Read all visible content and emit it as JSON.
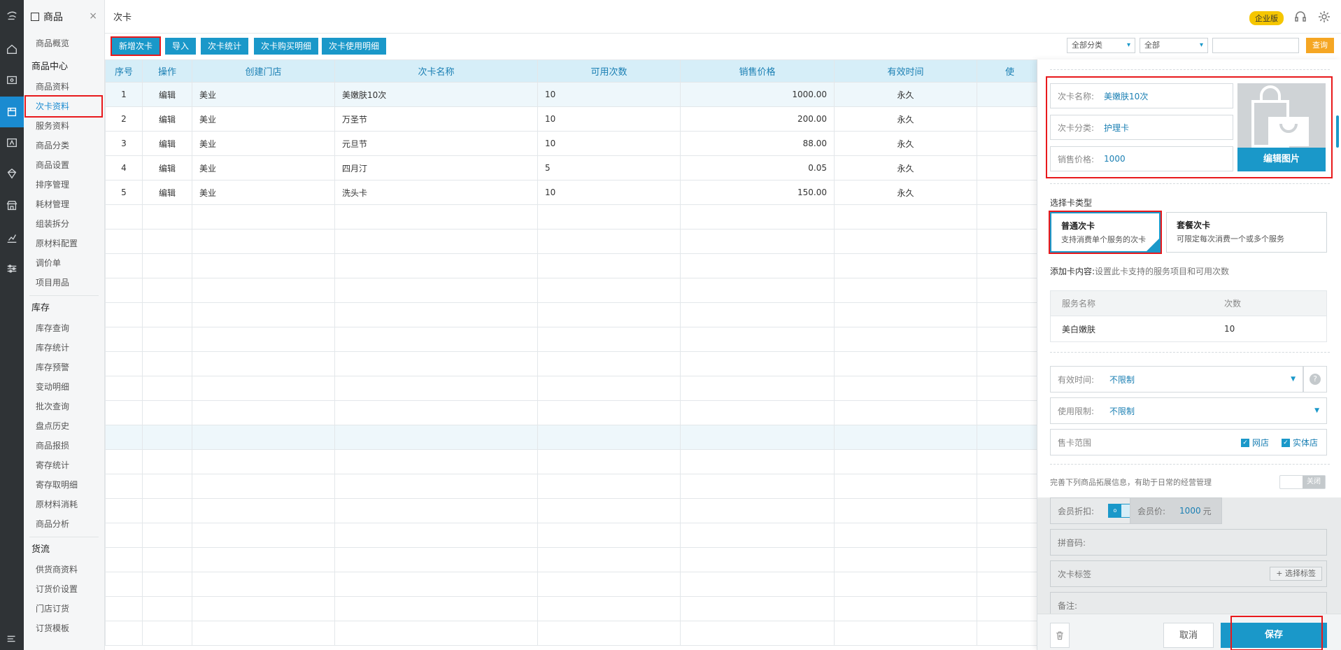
{
  "nav": {
    "module_title": "商品",
    "close_glyph": "×",
    "rail_icons": [
      "logo-icon",
      "home-icon",
      "wallet-icon",
      "goods-icon",
      "member-icon",
      "diamond-icon",
      "shop-icon",
      "chart-icon",
      "settings-sliders-icon",
      "menu-icon"
    ],
    "groups": [
      {
        "title": "",
        "items": [
          "商品概览"
        ]
      },
      {
        "title": "商品中心",
        "items": [
          "商品资料",
          "次卡资料",
          "服务资料",
          "商品分类",
          "商品设置",
          "排序管理",
          "耗材管理",
          "组装拆分",
          "原材料配置",
          "调价单",
          "项目用品"
        ]
      },
      {
        "title": "库存",
        "items": [
          "库存查询",
          "库存统计",
          "库存预警",
          "变动明细",
          "批次查询",
          "盘点历史",
          "商品报损",
          "寄存统计",
          "寄存取明细",
          "原材料消耗",
          "商品分析"
        ]
      },
      {
        "title": "货流",
        "items": [
          "供货商资料",
          "订货价设置",
          "门店订货",
          "订货模板"
        ]
      }
    ],
    "active_item": "次卡资料"
  },
  "header": {
    "title": "次卡",
    "edition_badge": "企业版",
    "icons": [
      "headset-icon",
      "gear-icon"
    ]
  },
  "toolbar": {
    "buttons": [
      "新增次卡",
      "导入",
      "次卡统计",
      "次卡购买明细",
      "次卡使用明细"
    ],
    "filter_category": "全部分类",
    "filter_all": "全部",
    "search_placeholder": "",
    "query_label": "查询"
  },
  "table": {
    "columns": [
      "序号",
      "操作",
      "创建门店",
      "次卡名称",
      "可用次数",
      "销售价格",
      "有效时间",
      "使"
    ],
    "rows": [
      [
        "1",
        "编辑",
        "美业",
        "美嫩肤10次",
        "10",
        "1000.00",
        "永久"
      ],
      [
        "2",
        "编辑",
        "美业",
        "万圣节",
        "10",
        "200.00",
        "永久"
      ],
      [
        "3",
        "编辑",
        "美业",
        "元旦节",
        "10",
        "88.00",
        "永久"
      ],
      [
        "4",
        "编辑",
        "美业",
        "四月汀",
        "5",
        "0.05",
        "永久"
      ],
      [
        "5",
        "编辑",
        "美业",
        "洗头卡",
        "10",
        "150.00",
        "永久"
      ]
    ]
  },
  "drawer": {
    "name_label": "次卡名称:",
    "name_value": "美嫩肤10次",
    "category_label": "次卡分类:",
    "category_value": "护理卡",
    "price_label": "销售价格:",
    "price_value": "1000",
    "edit_image": "编辑图片",
    "card_type_title": "选择卡类型",
    "card_types": [
      {
        "title": "普通次卡",
        "desc": "支持消费单个服务的次卡"
      },
      {
        "title": "套餐次卡",
        "desc": "可限定每次消费一个或多个服务"
      }
    ],
    "content_label": "添加卡内容:",
    "content_hint": "设置此卡支持的服务项目和可用次数",
    "service_header": [
      "服务名称",
      "次数"
    ],
    "service_rows": [
      [
        "美白嫩肤",
        "10"
      ]
    ],
    "valid_label": "有效时间:",
    "valid_value": "不限制",
    "limit_label": "使用限制:",
    "limit_value": "不限制",
    "scope_label": "售卡范围",
    "scope_online": "网店",
    "scope_store": "实体店",
    "extend_hint": "完善下列商品拓展信息，有助于日常的经营管理",
    "extend_toggle": "关闭",
    "member_discount_label": "会员折扣:",
    "member_price_label": "会员价:",
    "member_price_value": "1000",
    "member_price_unit": "元",
    "pinyin_label": "拼音码:",
    "tag_label": "次卡标签",
    "tag_button": "+ 选择标签",
    "note_label": "备注:",
    "cancel": "取消",
    "save": "保存"
  }
}
